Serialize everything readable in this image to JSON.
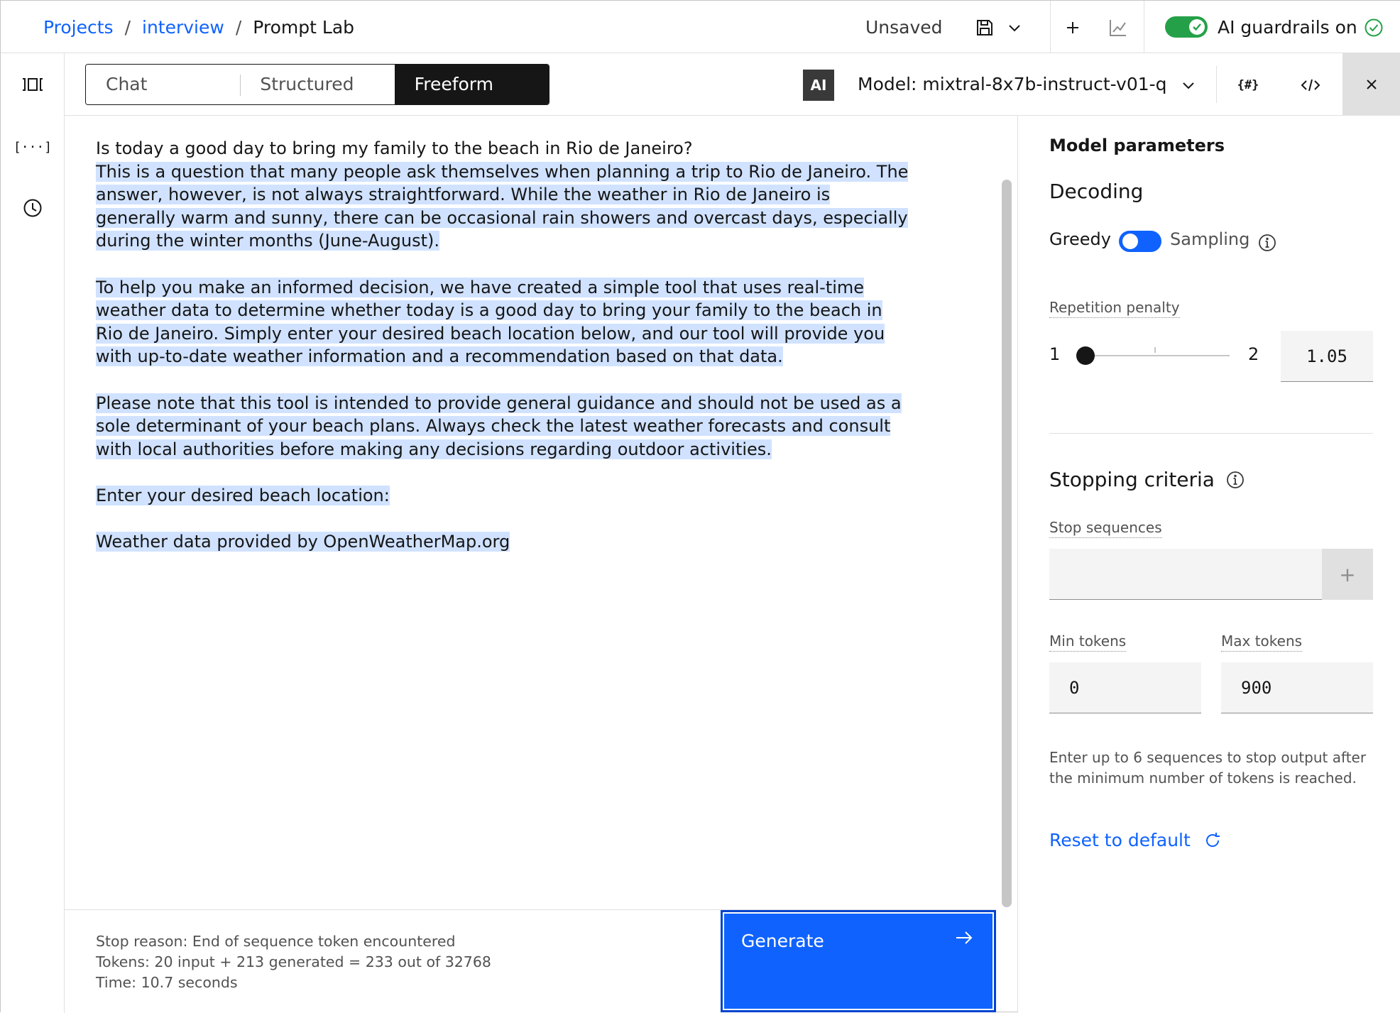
{
  "breadcrumb": {
    "items": [
      "Projects",
      "interview"
    ],
    "separator": "/",
    "current": "Prompt Lab"
  },
  "header": {
    "save_status": "Unsaved",
    "guardrails_label": "AI guardrails on",
    "guardrails_on": true
  },
  "mode_switcher": {
    "tabs": [
      {
        "label": "Chat",
        "active": false
      },
      {
        "label": "Structured",
        "active": false
      },
      {
        "label": "Freeform",
        "active": true
      }
    ]
  },
  "model": {
    "badge": "AI",
    "label": "Model: mixtral-8x7b-instruct-v01-q"
  },
  "editor": {
    "prompt": "Is today a good day to bring my family to the beach in Rio de Janeiro?",
    "generated_paragraphs": [
      "This is a question that many people ask themselves when planning a trip to Rio de Janeiro. The answer, however, is not always straightforward. While the weather in Rio de Janeiro is generally warm and sunny, there can be occasional rain showers and overcast days, especially during the winter months (June-August).",
      "To help you make an informed decision, we have created a simple tool that uses real-time weather data to determine whether today is a good day to bring your family to the beach in Rio de Janeiro. Simply enter your desired beach location below, and our tool will provide you with up-to-date weather information and a recommendation based on that data.",
      "Please note that this tool is intended to provide general guidance and should not be used as a sole determinant of your beach plans. Always check the latest weather forecasts and consult with local authorities before making any decisions regarding outdoor activities.",
      "Enter your desired beach location:",
      "Weather data provided by OpenWeatherMap.org"
    ]
  },
  "footer": {
    "stop_reason": "Stop reason: End of sequence token encountered",
    "tokens": "Tokens: 20 input + 213 generated = 233 out of 32768",
    "time": "Time: 10.7 seconds",
    "generate_label": "Generate"
  },
  "panel": {
    "title": "Model parameters",
    "decoding": {
      "heading": "Decoding",
      "option_left": "Greedy",
      "option_right": "Sampling",
      "sampling_enabled": false
    },
    "repetition_penalty": {
      "label": "Repetition penalty",
      "min": "1",
      "max": "2",
      "value": "1.05"
    },
    "stopping": {
      "heading": "Stopping criteria",
      "stop_sequences_label": "Stop sequences",
      "stop_sequences_value": "",
      "add_symbol": "+",
      "min_tokens_label": "Min tokens",
      "min_tokens_value": "0",
      "max_tokens_label": "Max tokens",
      "max_tokens_value": "900",
      "helper": "Enter up to 6 sequences to stop output after the minimum number of tokens is reached."
    },
    "reset_label": "Reset to default"
  },
  "colors": {
    "accent": "#0f62fe",
    "highlight": "#d0e2ff",
    "success": "#24a148",
    "dark": "#161616"
  }
}
